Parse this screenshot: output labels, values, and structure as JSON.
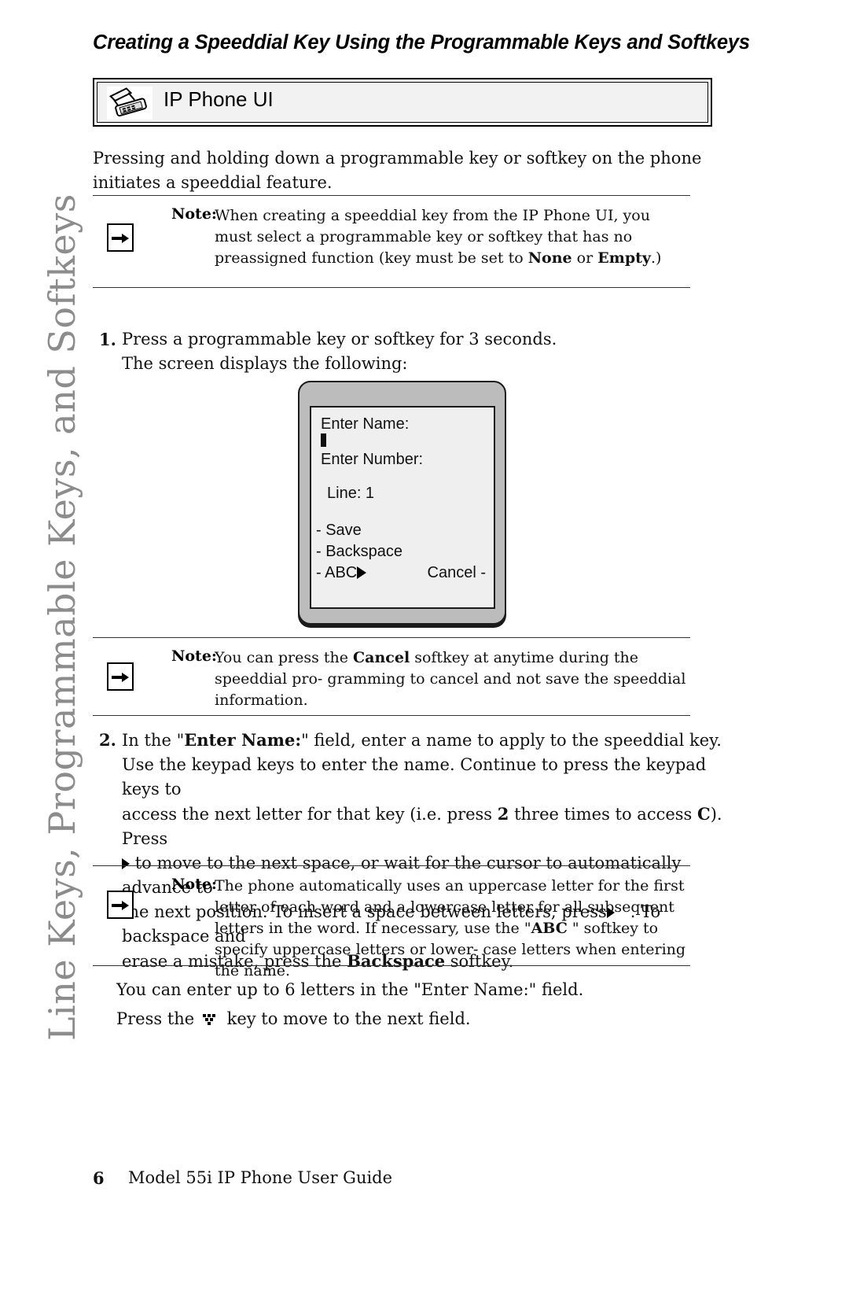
{
  "sidebar": {
    "running_head": "Line Keys, Programmable Keys, and Softkeys"
  },
  "page": {
    "title": "Creating a Speeddial Key Using the Programmable Keys and Softkeys"
  },
  "banner": {
    "label": "IP Phone UI",
    "icon": "desk-phone-icon"
  },
  "intro": {
    "text": "Pressing and holding down a programmable key or softkey on the phone initiates a speeddial feature."
  },
  "notes": [
    {
      "label": "Note:",
      "icon": "arrow-right-icon",
      "line_1": "When creating a speeddial key from the IP Phone UI, you must select a",
      "line_2": "programmable key or softkey that has no preassigned function (key must",
      "line_3_pre": "be set to ",
      "line_3_bold_1": "None",
      "line_3_mid": " or ",
      "line_3_bold_2": "Empty",
      "line_3_post": ".)"
    },
    {
      "label": "Note:",
      "icon": "arrow-right-icon",
      "line_1_pre": "You can press the ",
      "line_1_bold": "Cancel",
      "line_1_post": " softkey at anytime during the speeddial pro-",
      "line_2": "gramming to cancel and not save the speeddial information."
    },
    {
      "label": "Note:",
      "icon": "arrow-right-icon",
      "line_1": "The phone automatically uses an uppercase letter for the first letter of",
      "line_2": "each word and a lowercase letter for all subsequent letters in the word. If",
      "line_3_pre": "necessary, use the \"",
      "line_3_bold": "ABC",
      "line_3_post": " \" softkey to specify uppercase letters or lower-",
      "line_4": "case letters when entering the name."
    }
  ],
  "steps": [
    {
      "number": "1.",
      "line_1": "Press a programmable key or softkey for 3 seconds.",
      "line_2": "The screen displays the following:"
    },
    {
      "number": "2.",
      "line_1_pre": "In the \"",
      "line_1_bold": "Enter Name:",
      "line_1_post": "\" field, enter a name to apply to the speeddial key.",
      "line_2": "Use the keypad keys to enter the name. Continue to press the keypad keys to",
      "line_3_pre": "access the next letter for that key (i.e. press ",
      "line_3_bold_1": "2",
      "line_3_mid": " three times to access ",
      "line_3_bold_2": "C",
      "line_3_post": "). Press",
      "line_4": "to move to the next space, or wait for the cursor to automatically advance to",
      "line_5_pre": "the next position. To insert a space between letters, press",
      "line_5_post": ". To backspace and",
      "line_6_pre": "erase a mistake, press the ",
      "line_6_bold": "Backspace",
      "line_6_post": " softkey."
    }
  ],
  "phone_screen": {
    "enter_name_label": "Enter Name:",
    "enter_number_label": "Enter Number:",
    "line_label": "Line: 1",
    "softkey_save": "- Save",
    "softkey_backspace": "- Backspace",
    "softkey_abc": "- ABC",
    "softkey_cancel": "Cancel -",
    "cursor": "text-cursor"
  },
  "closing": {
    "line_1": "You can enter up to 6 letters in the \"Enter Name:\" field.",
    "line_2_pre": "Press the",
    "line_2_post": "key to move to the next field.",
    "keypad_icon": "pound-key-icon"
  },
  "footer": {
    "page_number": "6",
    "doc_title": "Model 55i IP Phone User Guide"
  }
}
